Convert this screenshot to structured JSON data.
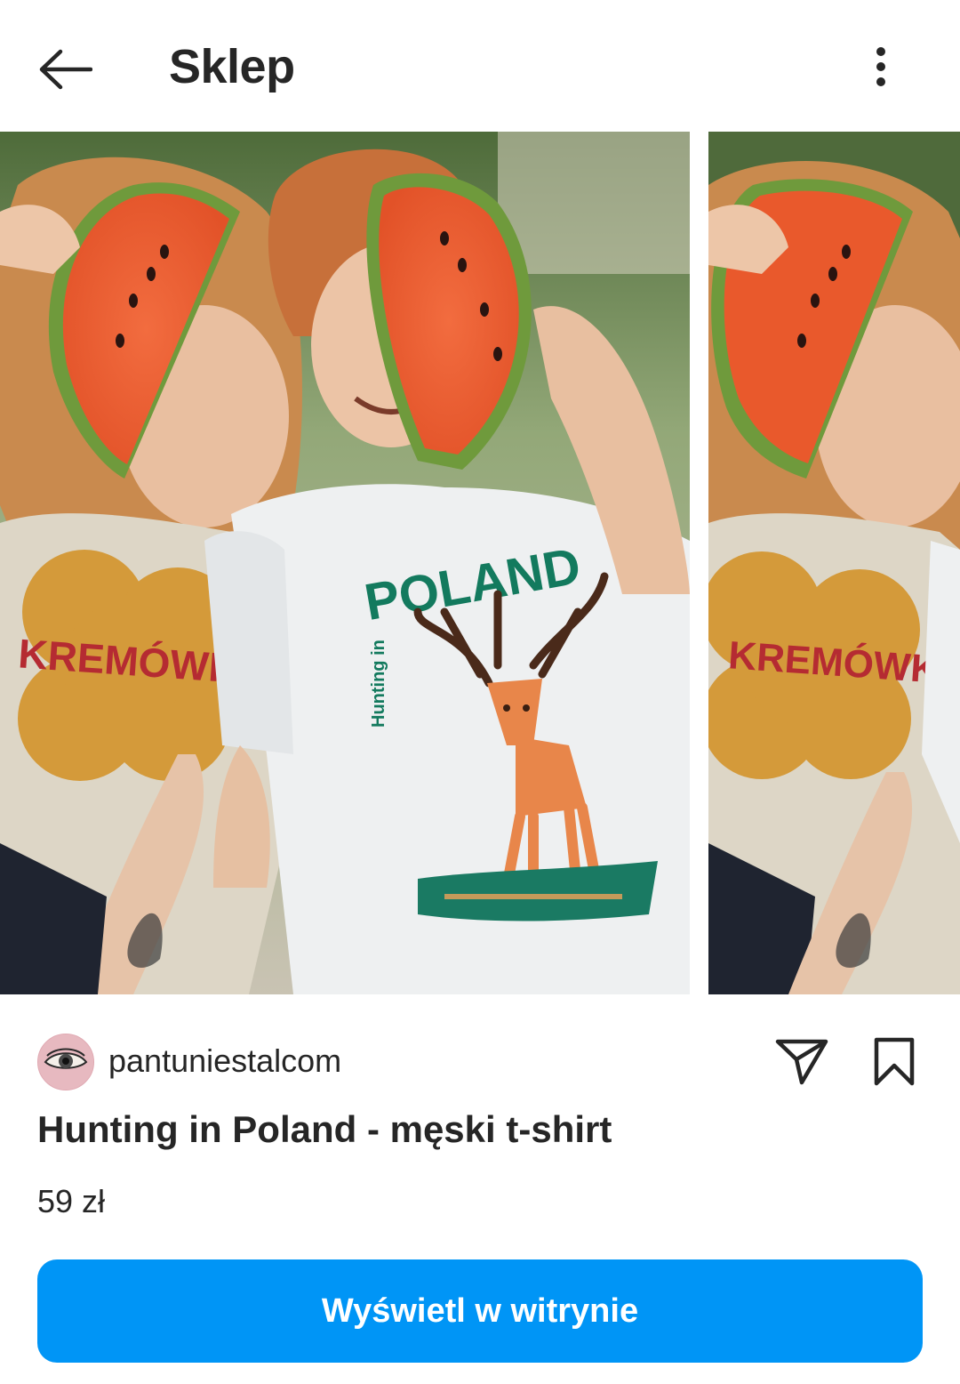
{
  "header": {
    "title": "Sklep",
    "back_icon": "arrow-left-icon",
    "more_icon": "more-vertical-icon"
  },
  "carousel": {
    "current_slide": 1,
    "progress_fraction": 0.26,
    "slides": [
      {
        "shirt_text_main": "POLAND",
        "shirt_text_side": "Hunting in",
        "second_shirt_text": "KREMÓWK"
      },
      {
        "second_shirt_text": "KREMÓWK"
      }
    ]
  },
  "seller": {
    "name": "pantuniestalcom",
    "avatar_icon": "eye-avatar-icon"
  },
  "actions": {
    "share_icon": "send-icon",
    "save_icon": "bookmark-icon"
  },
  "product": {
    "title": "Hunting in Poland - męski t-shirt",
    "price": "59 zł"
  },
  "cta": {
    "label": "Wyświetl w witrynie",
    "color": "#0095f6"
  }
}
